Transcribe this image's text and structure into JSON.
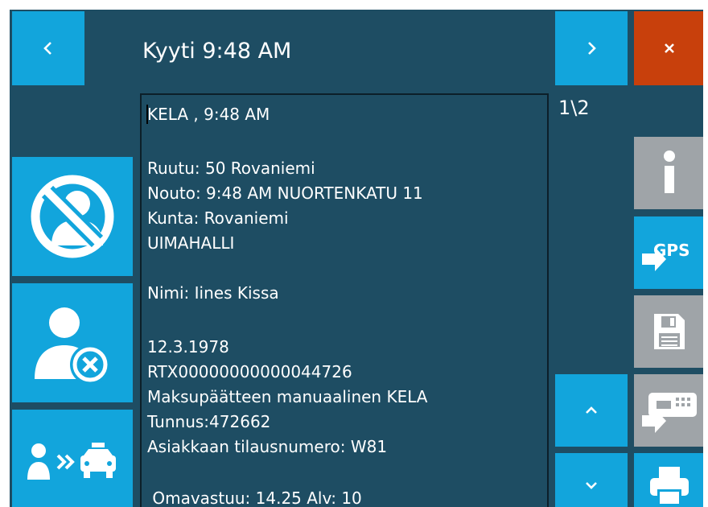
{
  "header": {
    "title": "Kyyti 9:48 AM",
    "page_indicator": "1\\2"
  },
  "content": {
    "lines": [
      "KELA , 9:48 AM",
      "Ruutu: 50 Rovaniemi",
      "Nouto: 9:48 AM NUORTENKATU 11",
      "Kunta: Rovaniemi",
      "UIMAHALLI",
      "Nimi: Iines Kissa",
      "12.3.1978",
      "RTX00000000000044726",
      "Maksupäätteen manuaalinen KELA",
      "Tunnus:472662",
      "Asiakkaan tilausnumero: W81",
      " Omavastuu: 14.25 Alv: 10"
    ]
  },
  "buttons": {
    "gps_label": "GPS"
  },
  "icons": {
    "prev": "chevron-left-icon",
    "next": "chevron-right-icon",
    "close": "close-icon",
    "no_show": "no-person-icon",
    "cancel_customer": "person-cancel-icon",
    "transfer": "person-to-taxi-icon",
    "info": "info-icon",
    "gps": "gps-send-icon",
    "save": "floppy-disk-icon",
    "payment_terminal": "payment-terminal-icon",
    "scroll_up": "chevron-up-icon",
    "scroll_down": "chevron-down-icon",
    "print": "printer-icon"
  },
  "colors": {
    "background": "#1e4d63",
    "tile_blue": "#12a5dc",
    "tile_gray": "#9fa4a8",
    "close_red": "#c8400c"
  }
}
